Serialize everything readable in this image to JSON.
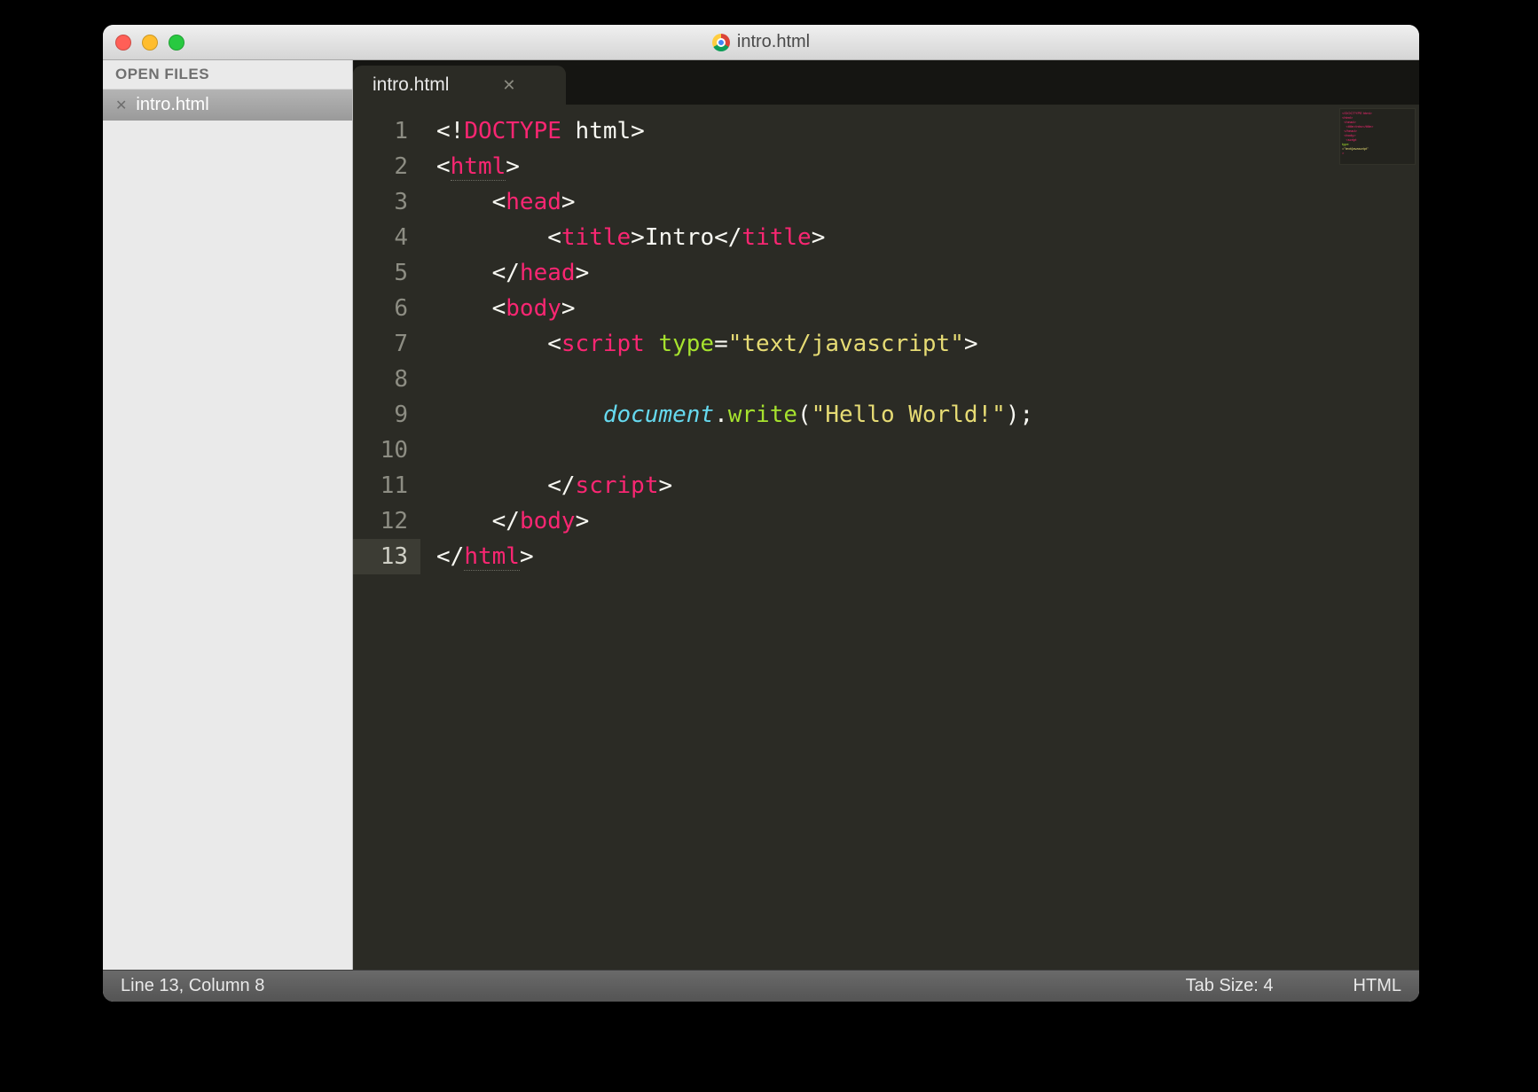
{
  "window": {
    "title": "intro.html"
  },
  "sidebar": {
    "header": "OPEN FILES",
    "items": [
      {
        "name": "intro.html"
      }
    ]
  },
  "tabs": [
    {
      "label": "intro.html",
      "active": true
    }
  ],
  "editor": {
    "cursor_line": 13,
    "lines": [
      {
        "n": 1,
        "indent": 0,
        "tokens": [
          [
            "p",
            "<!"
          ],
          [
            "tg",
            "DOCTYPE "
          ],
          [
            "p",
            "html>"
          ]
        ]
      },
      {
        "n": 2,
        "indent": 0,
        "tokens": [
          [
            "p",
            "<"
          ],
          [
            "tg",
            "html"
          ],
          [
            "p",
            ">"
          ]
        ],
        "underline_tag": true
      },
      {
        "n": 3,
        "indent": 1,
        "tokens": [
          [
            "p",
            "<"
          ],
          [
            "tg",
            "head"
          ],
          [
            "p",
            ">"
          ]
        ]
      },
      {
        "n": 4,
        "indent": 2,
        "tokens": [
          [
            "p",
            "<"
          ],
          [
            "tg",
            "title"
          ],
          [
            "p",
            ">"
          ],
          [
            "p",
            "Intro"
          ],
          [
            "p",
            "</"
          ],
          [
            "tg",
            "title"
          ],
          [
            "p",
            ">"
          ]
        ]
      },
      {
        "n": 5,
        "indent": 1,
        "tokens": [
          [
            "p",
            "</"
          ],
          [
            "tg",
            "head"
          ],
          [
            "p",
            ">"
          ]
        ]
      },
      {
        "n": 6,
        "indent": 1,
        "tokens": [
          [
            "p",
            "<"
          ],
          [
            "tg",
            "body"
          ],
          [
            "p",
            ">"
          ]
        ]
      },
      {
        "n": 7,
        "indent": 2,
        "tokens": [
          [
            "p",
            "<"
          ],
          [
            "tg",
            "script "
          ],
          [
            "kw",
            "type"
          ],
          [
            "p",
            "="
          ],
          [
            "st",
            "\"text/javascript\""
          ],
          [
            "p",
            ">"
          ]
        ]
      },
      {
        "n": 8,
        "indent": 2,
        "tokens": []
      },
      {
        "n": 9,
        "indent": 3,
        "tokens": [
          [
            "fn",
            "document"
          ],
          [
            "p",
            "."
          ],
          [
            "mt",
            "write"
          ],
          [
            "p",
            "("
          ],
          [
            "st",
            "\"Hello World!\""
          ],
          [
            "p",
            ");"
          ]
        ]
      },
      {
        "n": 10,
        "indent": 2,
        "tokens": []
      },
      {
        "n": 11,
        "indent": 2,
        "tokens": [
          [
            "p",
            "</"
          ],
          [
            "tg",
            "script"
          ],
          [
            "p",
            ">"
          ]
        ]
      },
      {
        "n": 12,
        "indent": 1,
        "tokens": [
          [
            "p",
            "</"
          ],
          [
            "tg",
            "body"
          ],
          [
            "p",
            ">"
          ]
        ]
      },
      {
        "n": 13,
        "indent": 0,
        "tokens": [
          [
            "p",
            "</"
          ],
          [
            "tg",
            "html"
          ],
          [
            "p",
            ">"
          ]
        ],
        "underline_tag": true
      }
    ]
  },
  "status": {
    "position": "Line 13, Column 8",
    "tab_size": "Tab Size: 4",
    "syntax": "HTML"
  }
}
